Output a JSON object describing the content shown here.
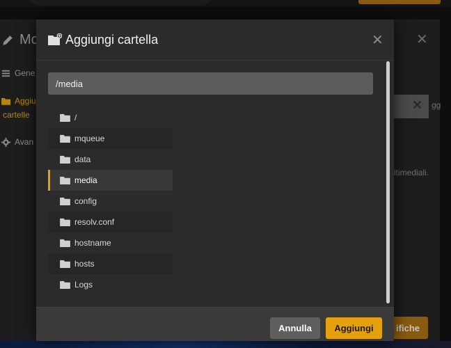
{
  "background": {
    "title": "Mo",
    "nav_general": "Gene",
    "nav_folders_line1": "Aggiu",
    "nav_folders_line2": "cartelle",
    "nav_advanced": "Avan",
    "side_text": "gg",
    "multimedia_text": "ltimediali.",
    "save_label": "ifiche",
    "close_symbol": "✕",
    "clear_symbol": "✕"
  },
  "dialog": {
    "title": "Aggiungi cartella",
    "close_symbol": "✕",
    "path_value": "/media",
    "folders": [
      {
        "label": "/",
        "selected": false
      },
      {
        "label": "mqueue",
        "selected": false
      },
      {
        "label": "data",
        "selected": false
      },
      {
        "label": "media",
        "selected": true
      },
      {
        "label": "config",
        "selected": false
      },
      {
        "label": "resolv.conf",
        "selected": false
      },
      {
        "label": "hostname",
        "selected": false
      },
      {
        "label": "hosts",
        "selected": false
      },
      {
        "label": "Logs",
        "selected": false
      }
    ],
    "cancel_label": "Annulla",
    "add_label": "Aggiungi"
  },
  "colors": {
    "accent": "#e5a00d",
    "dialog_bg": "#2b2b2b",
    "input_bg": "#5c5c5c"
  }
}
